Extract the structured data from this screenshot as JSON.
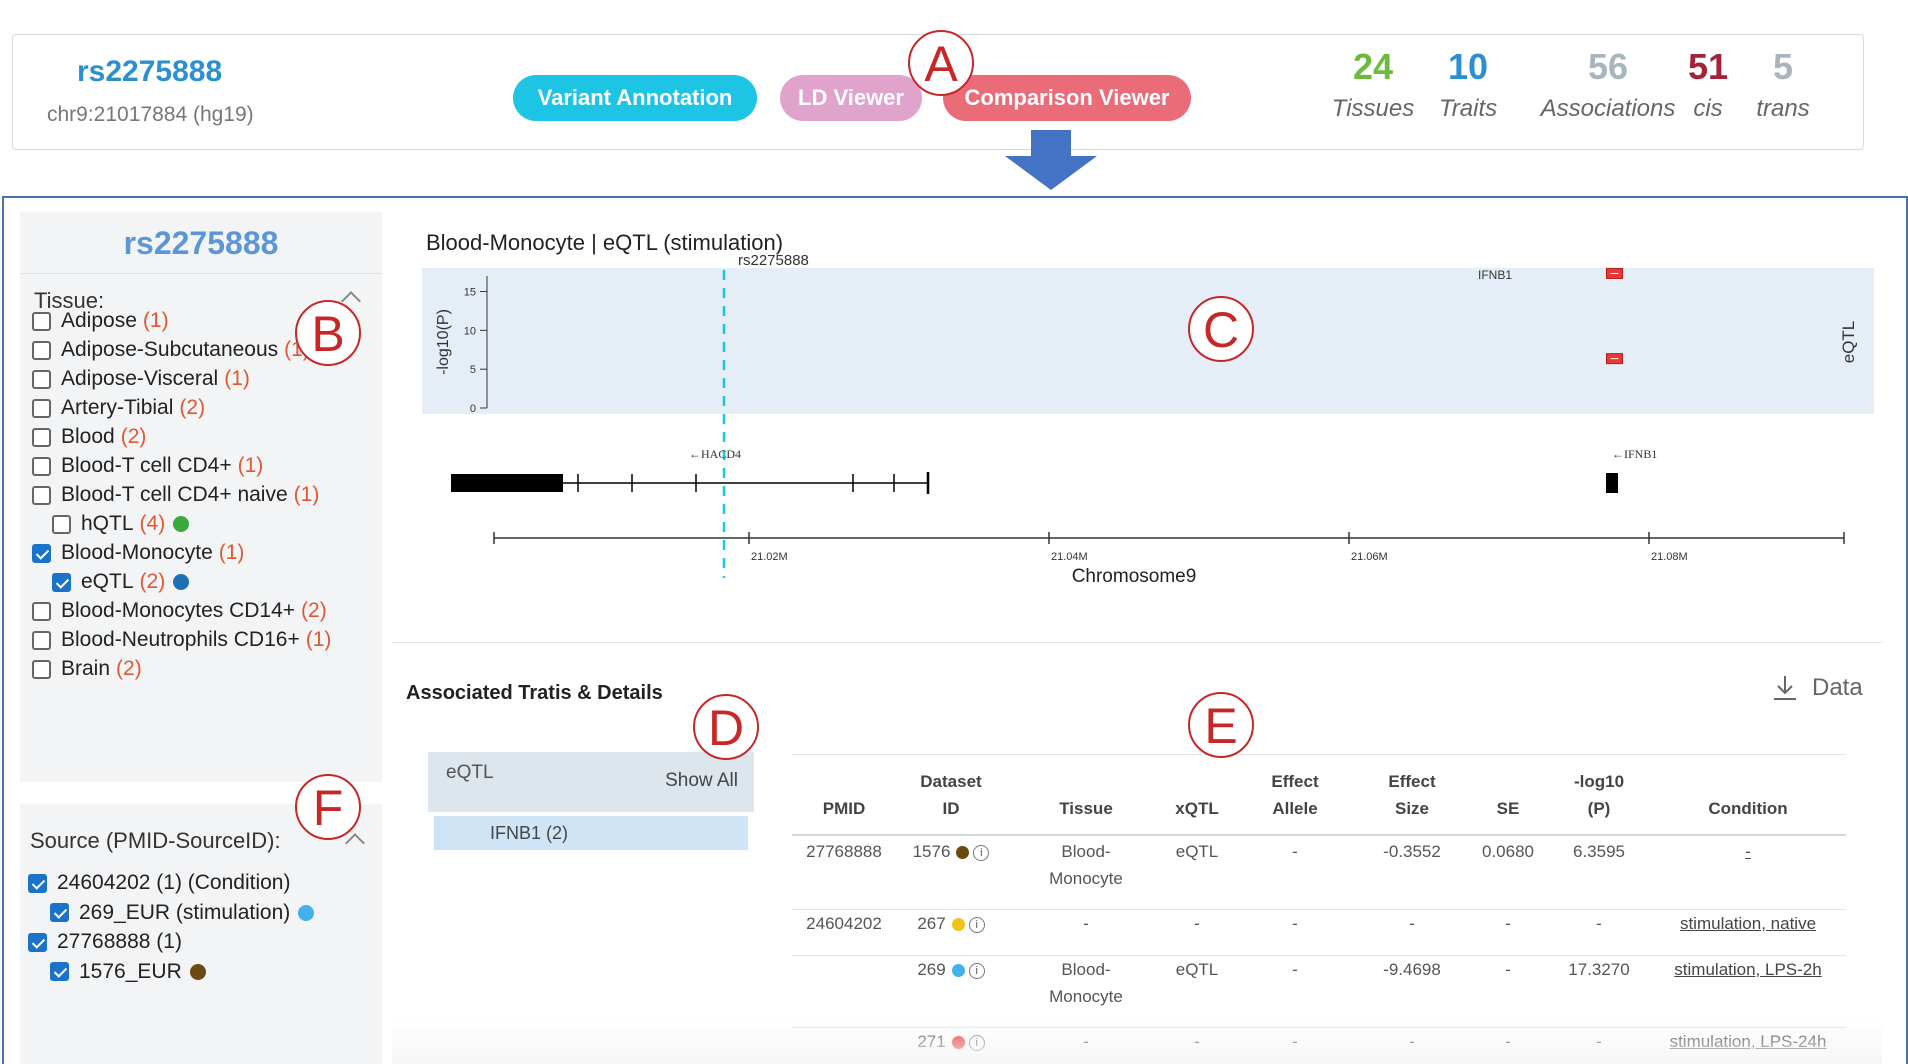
{
  "variant": {
    "rsid": "rs2275888",
    "coord": "chr9:21017884 (hg19)"
  },
  "nav": {
    "variant_annotation": "Variant Annotation",
    "ld_viewer": "LD Viewer",
    "comparison_viewer": "Comparison Viewer"
  },
  "stats": [
    {
      "value": "24",
      "label": "Tissues",
      "color": "#6cbb3c"
    },
    {
      "value": "10",
      "label": "Traits",
      "color": "#2c8fd0"
    },
    {
      "value": "56",
      "label": "Associations",
      "color": "#a9b5bd"
    },
    {
      "value": "51",
      "label": "cis",
      "color": "#a4223a"
    },
    {
      "value": "5",
      "label": "trans",
      "color": "#a9b5bd"
    }
  ],
  "markers": {
    "A": "A",
    "B": "B",
    "C": "C",
    "D": "D",
    "E": "E",
    "F": "F"
  },
  "sidebar": {
    "title": "rs2275888",
    "tissue_label": "Tissue:",
    "tissues": [
      {
        "label": "Adipose",
        "count": "(1)",
        "checked": false
      },
      {
        "label": "Adipose-Subcutaneous",
        "count": "(1)",
        "checked": false
      },
      {
        "label": "Adipose-Visceral",
        "count": "(1)",
        "checked": false
      },
      {
        "label": "Artery-Tibial",
        "count": "(2)",
        "checked": false
      },
      {
        "label": "Blood",
        "count": "(2)",
        "checked": false
      },
      {
        "label": "Blood-T cell CD4+",
        "count": "(1)",
        "checked": false
      },
      {
        "label": "Blood-T cell CD4+ naive",
        "count": "(1)",
        "checked": false
      },
      {
        "label": "hQTL",
        "count": "(4)",
        "checked": false,
        "sub": true,
        "dot": "#3aa83a"
      },
      {
        "label": "Blood-Monocyte",
        "count": "(1)",
        "checked": true
      },
      {
        "label": "eQTL",
        "count": "(2)",
        "checked": true,
        "sub": true,
        "dot": "#1f6fb5"
      },
      {
        "label": "Blood-Monocytes CD14+",
        "count": "(2)",
        "checked": false
      },
      {
        "label": "Blood-Neutrophils CD16+",
        "count": "(1)",
        "checked": false
      },
      {
        "label": "Brain",
        "count": "(2)",
        "checked": false
      }
    ],
    "source_label": "Source (PMID-SourceID):",
    "sources": [
      {
        "label": "24604202 (1) (Condition)",
        "checked": true
      },
      {
        "label": "269_EUR (stimulation)",
        "checked": true,
        "sub": true,
        "dot": "#42b0ea"
      },
      {
        "label": "27768888 (1)",
        "checked": true
      },
      {
        "label": "1576_EUR",
        "checked": true,
        "sub": true,
        "dot": "#6b4a12"
      }
    ]
  },
  "plot": {
    "title": "Blood-Monocyte | eQTL (stimulation)",
    "variant_label": "rs2275888",
    "ylabel": "-log10(P)",
    "right_label": "eQTL",
    "yticks": [
      "15",
      "10",
      "5",
      "0"
    ],
    "gene_top_label": "IFNB1",
    "genes": [
      "←HACD4",
      "←IFNB1"
    ],
    "xticks": [
      "21.02M",
      "21.04M",
      "21.06M",
      "21.08M"
    ],
    "xlabel": "Chromosome9"
  },
  "chart_data": {
    "type": "scatter",
    "title": "Blood-Monocyte | eQTL (stimulation)",
    "xlabel": "Chromosome9",
    "ylabel": "-log10(P)",
    "xlim": [
      21.003,
      21.093
    ],
    "ylim": [
      0,
      17
    ],
    "series": [
      {
        "name": "IFNB1",
        "x": [
          21.0777,
          21.0777
        ],
        "y": [
          17.327,
          6.3595
        ]
      }
    ],
    "annotations": [
      "rs2275888",
      "IFNB1"
    ]
  },
  "assoc": {
    "title": "Associated Tratis & Details",
    "data_button": "Data",
    "filter": {
      "label": "eQTL",
      "show_all": "Show All",
      "item": "IFNB1 (2)"
    },
    "headers": [
      [
        "PMID"
      ],
      [
        "Dataset",
        "ID"
      ],
      [
        "Tissue"
      ],
      [
        "xQTL"
      ],
      [
        "Effect",
        "Allele"
      ],
      [
        "Effect",
        "Size"
      ],
      [
        "SE"
      ],
      [
        "-log10",
        "(P)"
      ],
      [
        "Condition"
      ]
    ],
    "rows": [
      {
        "pmid": "27768888",
        "dataset": "1576",
        "dot": "#6b4a12",
        "tissue": [
          "Blood-",
          "Monocyte"
        ],
        "xqtl": "eQTL",
        "allele": "-",
        "size": "-0.3552",
        "se": "0.0680",
        "logp": "6.3595",
        "condition": "-"
      },
      {
        "pmid": "24604202",
        "dataset": "267",
        "dot": "#f2c21b",
        "tissue": [
          "-"
        ],
        "xqtl": "-",
        "allele": "-",
        "size": "-",
        "se": "-",
        "logp": "-",
        "condition": "stimulation, native"
      },
      {
        "pmid": "",
        "dataset": "269",
        "dot": "#42b0ea",
        "tissue": [
          "Blood-",
          "Monocyte"
        ],
        "xqtl": "eQTL",
        "allele": "-",
        "size": "-9.4698",
        "se": "-",
        "logp": "17.3270",
        "condition": "stimulation, LPS-2h"
      },
      {
        "pmid": "",
        "dataset": "271",
        "dot": "#e53935",
        "tissue": [
          "-"
        ],
        "xqtl": "-",
        "allele": "-",
        "size": "-",
        "se": "-",
        "logp": "-",
        "condition": "stimulation, LPS-24h"
      }
    ]
  }
}
